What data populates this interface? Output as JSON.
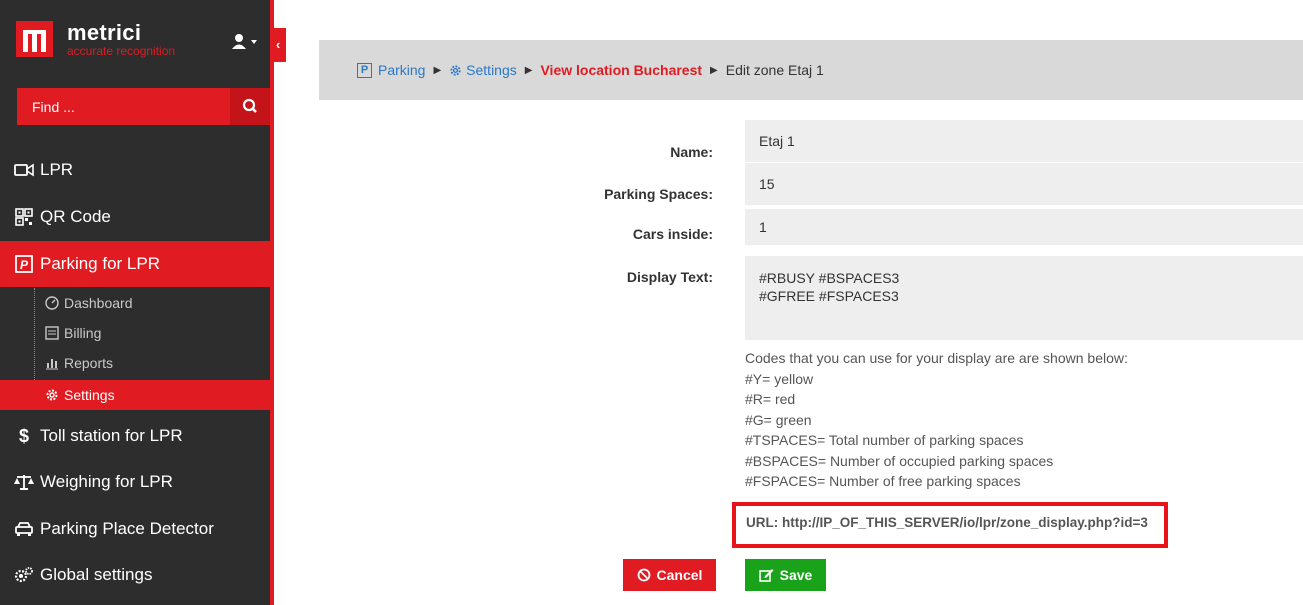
{
  "brand": {
    "name": "metrici",
    "tagline": "accurate recognition"
  },
  "search": {
    "placeholder": "Find ..."
  },
  "nav": {
    "lpr": "LPR",
    "qr": "QR Code",
    "parking": "Parking for LPR",
    "sub": {
      "dashboard": "Dashboard",
      "billing": "Billing",
      "reports": "Reports",
      "settings": "Settings"
    },
    "toll": "Toll station for LPR",
    "weighing": "Weighing for LPR",
    "detector": "Parking Place Detector",
    "global": "Global settings"
  },
  "breadcrumb": {
    "parking": "Parking",
    "settings": "Settings",
    "view_location": "View location Bucharest",
    "current": "Edit zone Etaj 1"
  },
  "form": {
    "name_label": "Name:",
    "name_value": "Etaj 1",
    "spaces_label": "Parking Spaces:",
    "spaces_value": "15",
    "cars_label": "Cars inside:",
    "cars_value": "1",
    "display_label": "Display Text:",
    "display_value": "#RBUSY #BSPACES3\n#GFREE #FSPACES3"
  },
  "help": {
    "intro": "Codes that you can use for your display are are shown below:",
    "y": "#Y= yellow",
    "r": "#R= red",
    "g": "#G= green",
    "tspaces": "#TSPACES= Total number of parking spaces",
    "bspaces": "#BSPACES= Number of occupied parking spaces",
    "fspaces": "#FSPACES= Number of free parking spaces"
  },
  "url": "URL: http://IP_OF_THIS_SERVER/io/lpr/zone_display.php?id=3",
  "buttons": {
    "cancel": "Cancel",
    "save": "Save"
  },
  "colors": {
    "accent": "#e01b22",
    "sidebar": "#2d2d2d",
    "save": "#1aa31a",
    "link": "#2a78c8"
  }
}
